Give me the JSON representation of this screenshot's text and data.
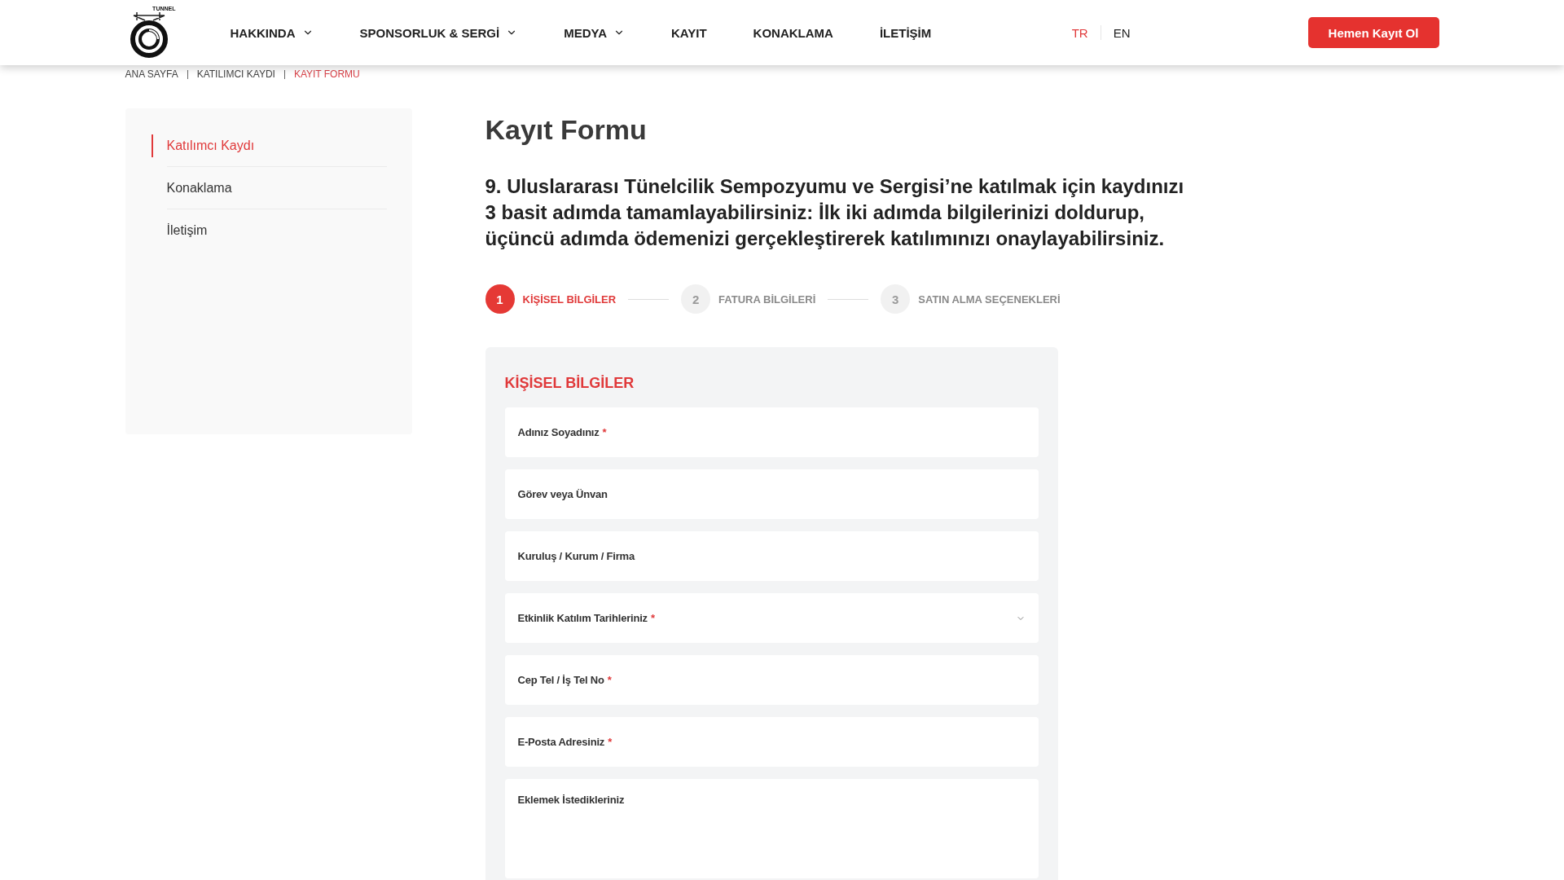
{
  "header": {
    "logo": {
      "text": "TUNNEL"
    },
    "nav": [
      {
        "label": "HAKKINDA",
        "dropdown": true
      },
      {
        "label": "SPONSORLUK & SERGİ",
        "dropdown": true
      },
      {
        "label": "MEDYA",
        "dropdown": true
      },
      {
        "label": "KAYIT",
        "dropdown": false
      },
      {
        "label": "KONAKLAMA",
        "dropdown": false
      },
      {
        "label": "İLETİŞİM",
        "dropdown": false
      }
    ],
    "languages": [
      {
        "label": "TR",
        "selected": true
      },
      {
        "label": "EN",
        "selected": false
      }
    ],
    "cta_button": "Hemen Kayıt Ol"
  },
  "breadcrumb": [
    {
      "label": "ANA SAYFA",
      "selected": false
    },
    {
      "label": "KATILIMCI KAYDI",
      "selected": false
    },
    {
      "label": "KAYIT FORMU",
      "selected": true
    }
  ],
  "sidebar": {
    "items": [
      {
        "label": "Katılımcı Kaydı",
        "selected": true
      },
      {
        "label": "Konaklama",
        "selected": false
      },
      {
        "label": "İletişim",
        "selected": false
      }
    ]
  },
  "main": {
    "title": "Kayıt Formu",
    "intro": "9. Uluslararası Tünelcilik Sempozyumu ve Sergisi’ne katılmak için kaydınızı 3 basit adımda tamamlayabilirsiniz: İlk iki adımda bilgilerinizi doldurup, üçüncü adımda ödemenizi gerçekleştirerek katılımınızı onaylayabilirsiniz.",
    "steps": [
      {
        "number": "1",
        "label": "KİŞİSEL BİLGİLER",
        "selected": true
      },
      {
        "number": "2",
        "label": "FATURA BİLGİLERİ",
        "selected": false
      },
      {
        "number": "3",
        "label": "SATIN ALMA SEÇENEKLERİ",
        "selected": false
      }
    ],
    "form": {
      "heading": "KİŞİSEL BİLGİLER",
      "fields": [
        {
          "kind": "text",
          "label": "Adınız Soyadınız",
          "required_mark": "*"
        },
        {
          "kind": "text",
          "label": "Görev veya Ünvan"
        },
        {
          "kind": "text",
          "label": "Kuruluş / Kurum / Firma"
        },
        {
          "kind": "select",
          "label": "Etkinlik Katılım Tarihleriniz",
          "required_mark": "*"
        },
        {
          "kind": "text",
          "label": "Cep Tel / İş Tel No",
          "required_mark": "*"
        },
        {
          "kind": "text",
          "label": "E-Posta Adresiniz",
          "required_mark": "*"
        },
        {
          "kind": "textarea",
          "label": "Eklemek İstedikleriniz"
        }
      ]
    }
  }
}
